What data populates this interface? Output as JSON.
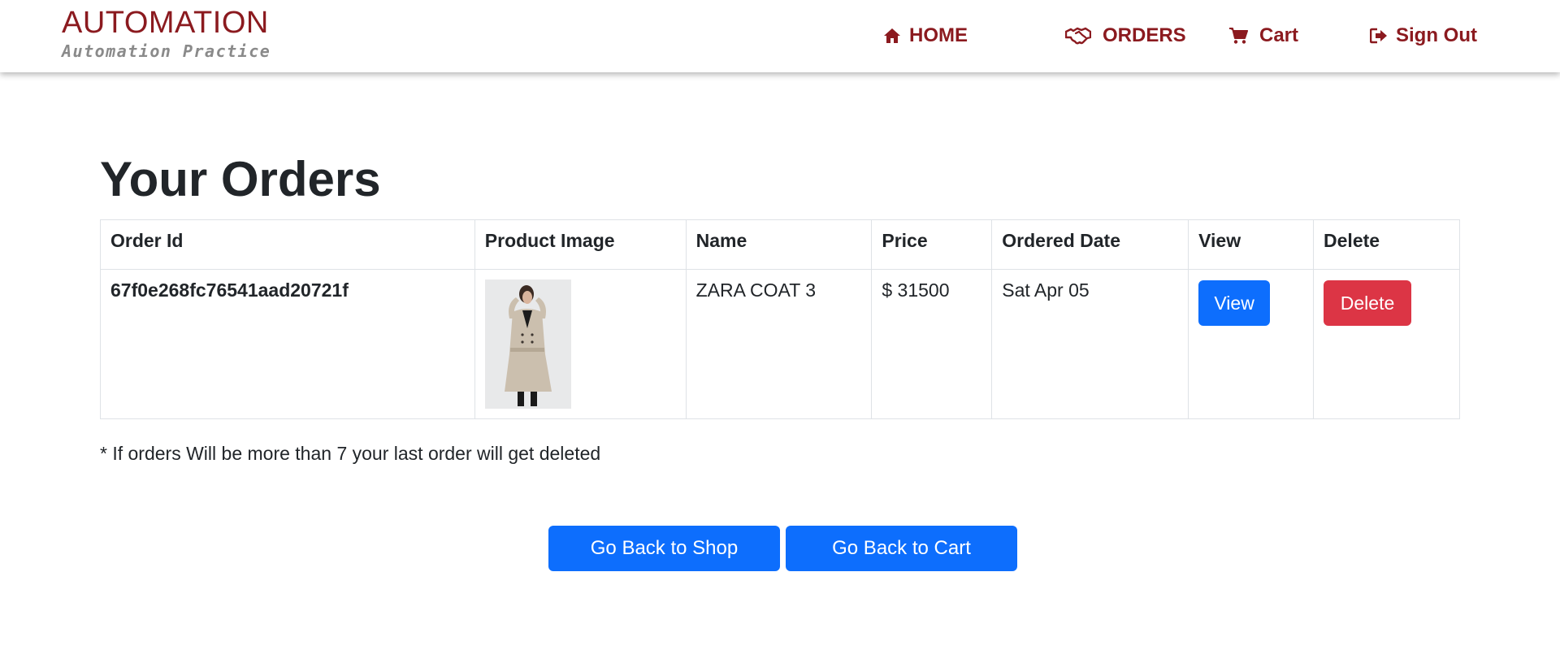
{
  "brand": {
    "title": "AUTOMATION",
    "subtitle": "Automation Practice",
    "color": "#8b1a1f"
  },
  "nav": {
    "home": {
      "label": "HOME",
      "icon": "home-icon"
    },
    "orders": {
      "label": "ORDERS",
      "icon": "handshake-icon"
    },
    "cart": {
      "label": "Cart",
      "icon": "shopping-cart-icon"
    },
    "signout": {
      "label": "Sign Out",
      "icon": "sign-out-icon"
    }
  },
  "page": {
    "title": "Your Orders"
  },
  "orders_table": {
    "headers": [
      "Order Id",
      "Product Image",
      "Name",
      "Price",
      "Ordered Date",
      "View",
      "Delete"
    ],
    "rows": [
      {
        "order_id": "67f0e268fc76541aad20721f",
        "product_image": "product-photo-zara-coat",
        "name": "ZARA COAT 3",
        "price": "$ 31500",
        "ordered_date": "Sat Apr 05",
        "view_label": "View",
        "delete_label": "Delete"
      }
    ]
  },
  "note": "* If orders Will be more than 7 your last order will get deleted",
  "actions": {
    "back_to_shop": "Go Back to Shop",
    "back_to_cart": "Go Back to Cart"
  },
  "colors": {
    "primary": "#0d6efd",
    "danger": "#dc3545",
    "brand": "#8b1a1f"
  }
}
